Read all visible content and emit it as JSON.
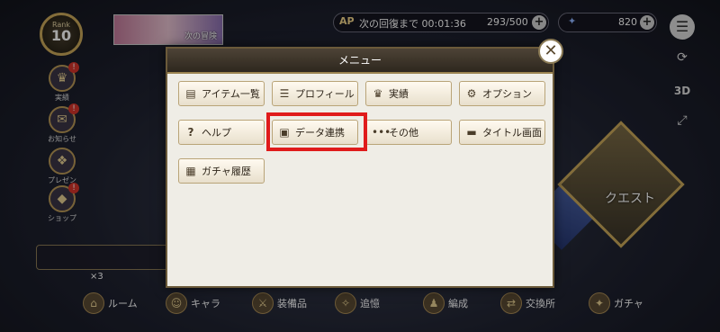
{
  "header": {
    "rank_label": "Rank",
    "rank_value": "10",
    "banner_text": "次の冒険",
    "ap_label": "AP",
    "recovery_text": "次の回復まで 00:01:36",
    "stamina": "293/500",
    "gems": "820"
  },
  "right_controls": {
    "view_3d": "3D"
  },
  "left_menu": [
    {
      "label": "実績",
      "icon": "trophy-icon"
    },
    {
      "label": "お知らせ",
      "icon": "mail-icon"
    },
    {
      "label": "プレゼント",
      "icon": "gift-icon"
    },
    {
      "label": "ショップ",
      "icon": "shop-icon"
    }
  ],
  "room_count": "×3",
  "bottom_nav": [
    {
      "label": "ルーム",
      "icon": "door-icon"
    },
    {
      "label": "キャラ",
      "icon": "character-icon"
    },
    {
      "label": "装備品",
      "icon": "equipment-icon"
    },
    {
      "label": "追憶",
      "icon": "memory-icon"
    },
    {
      "label": "編成",
      "icon": "formation-icon"
    },
    {
      "label": "交換所",
      "icon": "exchange-icon"
    },
    {
      "label": "ガチャ",
      "icon": "gacha-icon"
    }
  ],
  "quest_label": "クエスト",
  "dialog": {
    "title": "メニュー",
    "buttons": [
      {
        "label": "アイテム一覧",
        "icon": "item-list-icon"
      },
      {
        "label": "プロフィール",
        "icon": "profile-icon"
      },
      {
        "label": "実績",
        "icon": "trophy-icon"
      },
      {
        "label": "オプション",
        "icon": "gear-icon"
      },
      {
        "label": "ヘルプ",
        "icon": "help-icon"
      },
      {
        "label": "データ連携",
        "icon": "data-link-icon"
      },
      {
        "label": "その他",
        "icon": "more-icon"
      },
      {
        "label": "タイトル画面",
        "icon": "title-screen-icon"
      },
      {
        "label": "ガチャ履歴",
        "icon": "gacha-history-icon"
      }
    ],
    "highlighted": "データ連携"
  },
  "colors": {
    "highlight": "#e01b1b",
    "accent_gold": "#c9a85a"
  }
}
